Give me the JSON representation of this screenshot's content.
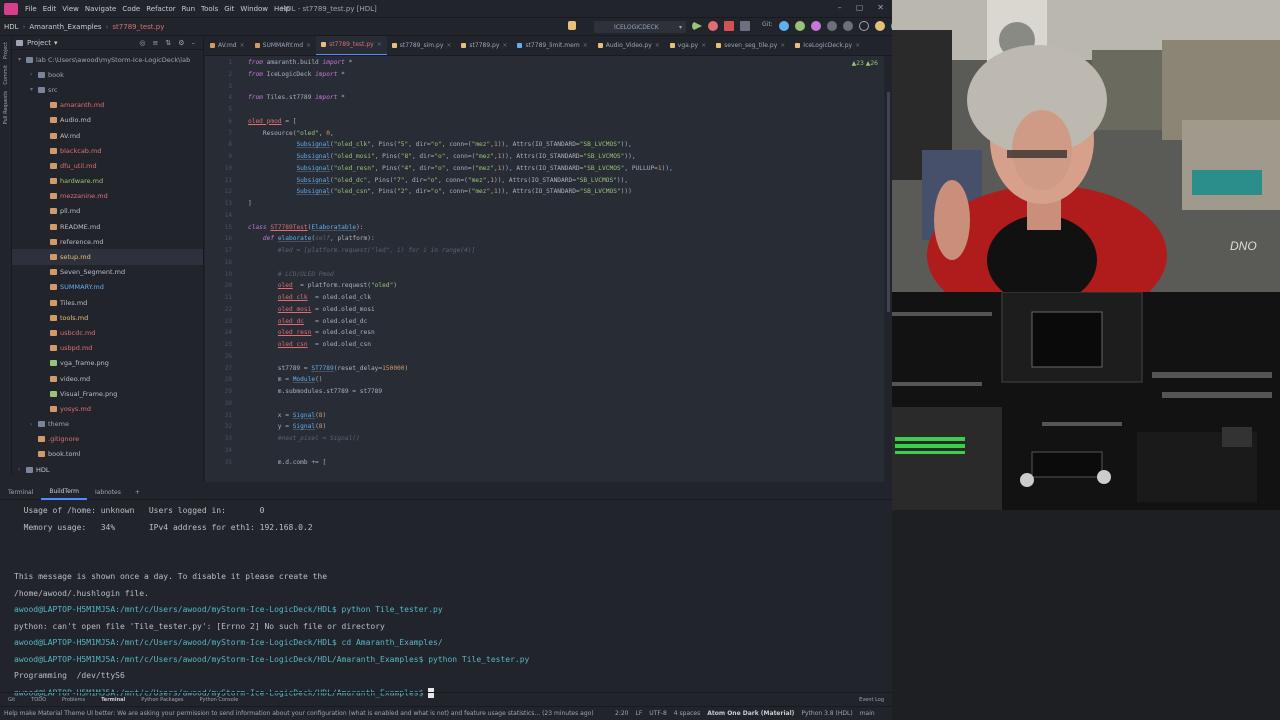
{
  "menubar": {
    "items": [
      "File",
      "Edit",
      "View",
      "Navigate",
      "Code",
      "Refactor",
      "Run",
      "Tools",
      "Git",
      "Window",
      "Help"
    ],
    "window_title": "HDL - st7789_test.py [HDL]"
  },
  "navbar": {
    "crumbs": [
      "HDL",
      "Amaranth_Examples",
      "st7789_test.py"
    ],
    "run_config": "ICELOGICDECK",
    "git_label": "Git:"
  },
  "project": {
    "title": "Project",
    "items": [
      {
        "label": "lab  C:\\Users\\awood\\myStorm-Ice-LogicDeck\\lab",
        "type": "folder",
        "color": "#9da5b4",
        "indent": 0
      },
      {
        "label": "book",
        "type": "folder",
        "color": "#9da5b4",
        "indent": 1
      },
      {
        "label": "src",
        "type": "folder",
        "color": "#9da5b4",
        "indent": 1
      },
      {
        "label": "amaranth.md",
        "type": "file",
        "color": "#e06c75",
        "indent": 2
      },
      {
        "label": "Audio.md",
        "type": "file",
        "color": "#bcbec4",
        "indent": 2
      },
      {
        "label": "AV.md",
        "type": "file",
        "color": "#bcbec4",
        "indent": 2
      },
      {
        "label": "blackcab.md",
        "type": "file",
        "color": "#e06c75",
        "indent": 2
      },
      {
        "label": "dfu_util.md",
        "type": "file",
        "color": "#e06c75",
        "indent": 2
      },
      {
        "label": "hardware.md",
        "type": "file",
        "color": "#98c379",
        "indent": 2
      },
      {
        "label": "mezzanine.md",
        "type": "file",
        "color": "#e06c75",
        "indent": 2
      },
      {
        "label": "pll.md",
        "type": "file",
        "color": "#bcbec4",
        "indent": 2
      },
      {
        "label": "README.md",
        "type": "file",
        "color": "#bcbec4",
        "indent": 2
      },
      {
        "label": "reference.md",
        "type": "file",
        "color": "#bcbec4",
        "indent": 2
      },
      {
        "label": "setup.md",
        "type": "file",
        "color": "#e5c07b",
        "indent": 2
      },
      {
        "label": "Seven_Segment.md",
        "type": "file",
        "color": "#bcbec4",
        "indent": 2
      },
      {
        "label": "SUMMARY.md",
        "type": "file",
        "color": "#61afef",
        "indent": 2
      },
      {
        "label": "Tiles.md",
        "type": "file",
        "color": "#bcbec4",
        "indent": 2
      },
      {
        "label": "tools.md",
        "type": "file",
        "color": "#e5c07b",
        "indent": 2
      },
      {
        "label": "usbcdc.md",
        "type": "file",
        "color": "#e06c75",
        "indent": 2
      },
      {
        "label": "usbpd.md",
        "type": "file",
        "color": "#e06c75",
        "indent": 2
      },
      {
        "label": "vga_frame.png",
        "type": "image",
        "color": "#bcbec4",
        "indent": 2
      },
      {
        "label": "video.md",
        "type": "file",
        "color": "#bcbec4",
        "indent": 2
      },
      {
        "label": "Visual_Frame.png",
        "type": "image",
        "color": "#bcbec4",
        "indent": 2
      },
      {
        "label": "yosys.md",
        "type": "file",
        "color": "#e06c75",
        "indent": 2
      },
      {
        "label": "theme",
        "type": "folder",
        "color": "#9da5b4",
        "indent": 1
      },
      {
        "label": ".gitignore",
        "type": "file",
        "color": "#e06c75",
        "indent": 1
      },
      {
        "label": "book.toml",
        "type": "file",
        "color": "#bcbec4",
        "indent": 1
      },
      {
        "label": "HDL",
        "type": "folder",
        "color": "#c9ccd2",
        "indent": 0
      }
    ]
  },
  "editor": {
    "tabs": [
      {
        "label": "AV.md",
        "active": false
      },
      {
        "label": "SUMMARY.md",
        "active": false
      },
      {
        "label": "st7789_test.py",
        "active": true
      },
      {
        "label": "st7789_sim.py",
        "active": false
      },
      {
        "label": "st7789.py",
        "active": false
      },
      {
        "label": "st7789_limit.mem",
        "active": false
      },
      {
        "label": "Audio_Video.py",
        "active": false
      },
      {
        "label": "vga.py",
        "active": false
      },
      {
        "label": "seven_seg_tile.py",
        "active": false
      },
      {
        "label": "IceLogicDeck.py",
        "active": false
      }
    ],
    "inspections": "▲23  ▲26",
    "lines": [
      {
        "n": "1",
        "html": "<span class='k'>from</span> amaranth.build <span class='k'>import</span> *"
      },
      {
        "n": "2",
        "html": "<span class='k'>from</span> IceLogicDeck <span class='k'>import</span> *"
      },
      {
        "n": "3",
        "html": ""
      },
      {
        "n": "4",
        "html": "<span class='k'>from</span> Tiles.st7789 <span class='k'>import</span> *"
      },
      {
        "n": "5",
        "html": ""
      },
      {
        "n": "6",
        "html": "<span class='v'>oled_pmod</span> = ["
      },
      {
        "n": "7",
        "html": "    Resource(<span class='s'>\"oled\"</span>, <span class='n'>0</span>,"
      },
      {
        "n": "8",
        "html": "             <span class='f'>Subsignal</span>(<span class='s'>\"oled_clk\"</span>, Pins(<span class='s'>\"5\"</span>, dir=<span class='s'>\"o\"</span>, conn=(<span class='s'>\"mez\"</span>,<span class='n'>1</span>)), Attrs(IO_STANDARD=<span class='s'>\"SB_LVCMOS\"</span>)),"
      },
      {
        "n": "9",
        "html": "             <span class='f'>Subsignal</span>(<span class='s'>\"oled_mosi\"</span>, Pins(<span class='s'>\"8\"</span>, dir=<span class='s'>\"o\"</span>, conn=(<span class='s'>\"mez\"</span>,<span class='n'>1</span>)), Attrs(IO_STANDARD=<span class='s'>\"SB_LVCMOS\"</span>)),"
      },
      {
        "n": "10",
        "html": "             <span class='f'>Subsignal</span>(<span class='s'>\"oled_resn\"</span>, Pins(<span class='s'>\"4\"</span>, dir=<span class='s'>\"o\"</span>, conn=(<span class='s'>\"mez\"</span>,<span class='n'>1</span>)), Attrs(IO_STANDARD=<span class='s'>\"SB_LVCMOS\"</span>, PULLUP=<span class='n'>1</span>)),"
      },
      {
        "n": "11",
        "html": "             <span class='f'>Subsignal</span>(<span class='s'>\"oled_dc\"</span>, Pins(<span class='s'>\"7\"</span>, dir=<span class='s'>\"o\"</span>, conn=(<span class='s'>\"mez\"</span>,<span class='n'>1</span>)), Attrs(IO_STANDARD=<span class='s'>\"SB_LVCMOS\"</span>)),"
      },
      {
        "n": "12",
        "html": "             <span class='f'>Subsignal</span>(<span class='s'>\"oled_csn\"</span>, Pins(<span class='s'>\"2\"</span>, dir=<span class='s'>\"o\"</span>, conn=(<span class='s'>\"mez\"</span>,<span class='n'>1</span>)), Attrs(IO_STANDARD=<span class='s'>\"SB_LVCMOS\"</span>)))"
      },
      {
        "n": "13",
        "html": "]"
      },
      {
        "n": "14",
        "html": ""
      },
      {
        "n": "15",
        "html": "<span class='k'>class</span> <span class='v'>ST7789Test</span>(<span class='f'>Elaboratable</span>):"
      },
      {
        "n": "16",
        "html": "    <span class='k'>def</span> <span class='f'>elaborate</span>(<span class='c'>self</span>, platform):"
      },
      {
        "n": "17",
        "html": "        <span class='c'>#led = [platform.request(\"led\", i) for i in range(4)]</span>"
      },
      {
        "n": "18",
        "html": ""
      },
      {
        "n": "19",
        "html": "        <span class='c'># LCD/OLED Pmod</span>"
      },
      {
        "n": "20",
        "html": "        <span class='v'>oled</span>  = platform.request(<span class='s'>\"oled\"</span>)"
      },
      {
        "n": "21",
        "html": "        <span class='v'>oled_clk</span>  = oled.oled_clk"
      },
      {
        "n": "22",
        "html": "        <span class='v'>oled_mosi</span> = oled.oled_mosi"
      },
      {
        "n": "23",
        "html": "        <span class='v'>oled_dc</span>   = oled.oled_dc"
      },
      {
        "n": "24",
        "html": "        <span class='v'>oled_resn</span> = oled.oled_resn"
      },
      {
        "n": "25",
        "html": "        <span class='v'>oled_csn</span>  = oled.oled_csn"
      },
      {
        "n": "26",
        "html": ""
      },
      {
        "n": "27",
        "html": "        st7789 = <span class='f'>ST7789</span>(reset_delay=<span class='n'>150000</span>)"
      },
      {
        "n": "28",
        "html": "        m = <span class='f'>Module</span>()"
      },
      {
        "n": "29",
        "html": "        m.submodules.st7789 = st7789"
      },
      {
        "n": "30",
        "html": ""
      },
      {
        "n": "31",
        "html": "        x = <span class='f'>Signal</span>(<span class='n'>8</span>)"
      },
      {
        "n": "32",
        "html": "        y = <span class='f'>Signal</span>(<span class='n'>8</span>)"
      },
      {
        "n": "33",
        "html": "        <span class='c'>#next_pixel = Signal()</span>"
      },
      {
        "n": "34",
        "html": ""
      },
      {
        "n": "35",
        "html": "        m.d.comb += ["
      }
    ]
  },
  "terminal": {
    "tabs": [
      "Terminal",
      "BuildTerm",
      "Iabnotes"
    ],
    "active_tab": "BuildTerm",
    "lines": [
      "  Usage of /home: unknown   Users logged in:       0",
      "  Memory usage:   34%       IPv4 address for eth1: 192.168.0.2",
      "",
      "",
      "This message is shown once a day. To disable it please create the",
      "/home/awood/.hushlogin file.",
      "awood@LAPTOP-H5M1MJ5A:/mnt/c/Users/awood/myStorm-Ice-LogicDeck/HDL$ python Tile_tester.py",
      "python: can't open file 'Tile_tester.py': [Errno 2] No such file or directory",
      "awood@LAPTOP-H5M1MJ5A:/mnt/c/Users/awood/myStorm-Ice-LogicDeck/HDL$ cd Amaranth_Examples/",
      "awood@LAPTOP-H5M1MJ5A:/mnt/c/Users/awood/myStorm-Ice-LogicDeck/HDL/Amaranth_Examples$ python Tile_tester.py",
      "Programming  /dev/ttyS6",
      "awood@LAPTOP-H5M1MJ5A:/mnt/c/Users/awood/myStorm-Ice-LogicDeck/HDL/Amaranth_Examples$ "
    ]
  },
  "bottom_tools": [
    "Git",
    "TODO",
    "Problems",
    "Terminal",
    "Python Packages",
    "Python Console",
    "Event Log"
  ],
  "statusbar": {
    "message": "Help make Material Theme UI better: We are asking your permission to send information about your configuration (what is enabled and what is not) and feature usage statistics... (23 minutes ago)",
    "position": "2:20",
    "line_sep": "LF",
    "encoding": "UTF-8",
    "indent": "4 spaces",
    "theme": "Atom One Dark (Material)",
    "interpreter": "Python 3.8 (HDL)",
    "branch": "main"
  },
  "webcam": {
    "overlay": "DNO"
  },
  "colors": {
    "accent": "#528bff",
    "bg_editor": "#282c34",
    "bg_panel": "#21252b"
  }
}
